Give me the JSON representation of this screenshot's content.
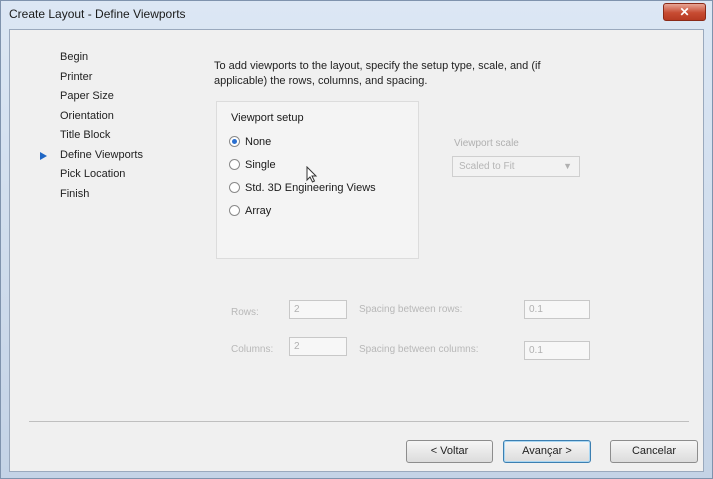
{
  "window": {
    "title": "Create Layout - Define Viewports",
    "close_glyph": "✕"
  },
  "steps": {
    "items": [
      "Begin",
      "Printer",
      "Paper Size",
      "Orientation",
      "Title Block",
      "Define Viewports",
      "Pick Location",
      "Finish"
    ],
    "current_index": 5,
    "current_marker_icon": "triangle-right-icon"
  },
  "main": {
    "instruction": "To add viewports to the layout, specify the setup type, scale, and (if applicable) the rows, columns, and spacing.",
    "viewport_setup": {
      "label": "Viewport setup",
      "options": [
        "None",
        "Single",
        "Std. 3D Engineering Views",
        "Array"
      ],
      "selected": "None"
    },
    "viewport_scale": {
      "label": "Viewport scale",
      "value": "Scaled to Fit"
    },
    "rows": {
      "label": "Rows:",
      "value": "2"
    },
    "spacing_rows": {
      "label": "Spacing between rows:",
      "value": "0.1"
    },
    "columns": {
      "label": "Columns:",
      "value": "2"
    },
    "spacing_columns": {
      "label": "Spacing between columns:",
      "value": "0.1"
    }
  },
  "buttons": {
    "back": "< Voltar",
    "next": "Avançar >",
    "cancel": "Cancelar"
  },
  "colors": {
    "accent": "#1f66c4",
    "close_button": "#c74b32"
  }
}
